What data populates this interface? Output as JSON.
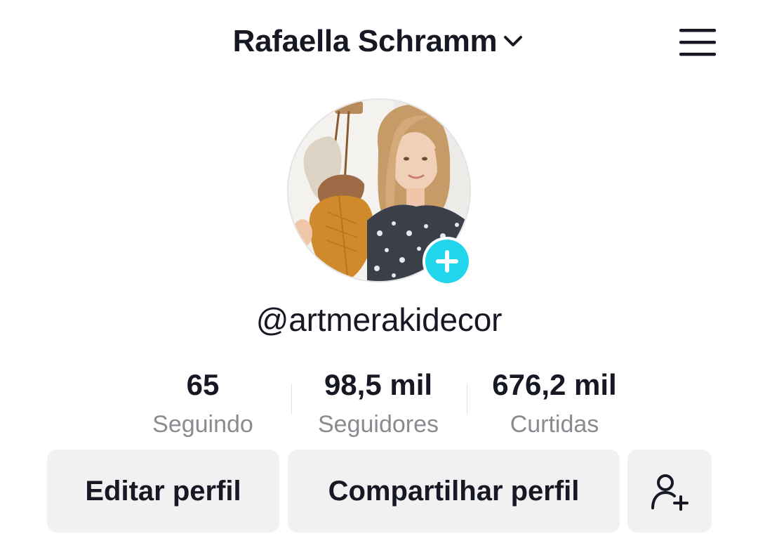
{
  "header": {
    "name": "Rafaella Schramm",
    "dropdown_icon": "chevron-down-icon",
    "menu_icon": "hamburger-menu-icon"
  },
  "profile": {
    "avatar": "profile-photo",
    "add_icon": "plus-icon",
    "accent_color": "#20d5ec",
    "handle": "@artmerakidecor"
  },
  "stats": [
    {
      "value": "65",
      "label": "Seguindo"
    },
    {
      "value": "98,5 mil",
      "label": "Seguidores"
    },
    {
      "value": "676,2 mil",
      "label": "Curtidas"
    }
  ],
  "actions": {
    "edit_label": "Editar perfil",
    "share_label": "Compartilhar perfil",
    "add_friend_icon": "add-friend-icon"
  }
}
